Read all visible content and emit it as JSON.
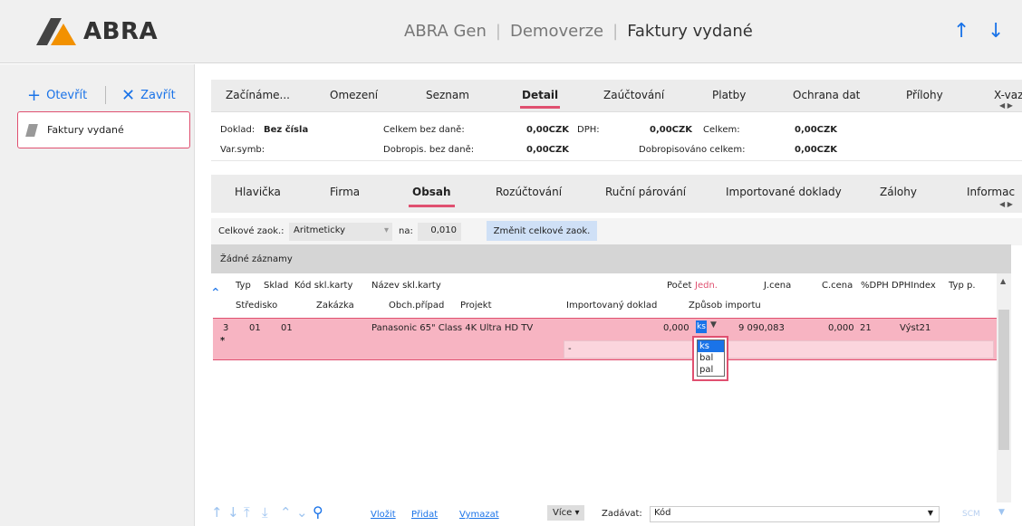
{
  "app": {
    "logo": "ABRA",
    "title_parts": [
      "ABRA Gen",
      "Demoverze"
    ],
    "current": "Faktury vydané"
  },
  "left": {
    "open_label": "Otevřít",
    "close_label": "Zavřít",
    "doc_item": "Faktury vydané"
  },
  "main_tabs": [
    "Začínáme...",
    "Omezení",
    "Seznam",
    "Detail",
    "Zaúčtování",
    "Platby",
    "Ochrana dat",
    "Přílohy",
    "X-vaz"
  ],
  "summary": {
    "doklad_label": "Doklad:",
    "doklad_value": "Bez čísla",
    "varsym_label": "Var.symb:",
    "celkem_bez_dane_label": "Celkem bez daně:",
    "celkem_bez_dane_value": "0,00CZK",
    "dph_label": "DPH:",
    "dph_value": "0,00CZK",
    "celkem_label": "Celkem:",
    "celkem_value": "0,00CZK",
    "dobropis_label": "Dobropis. bez daně:",
    "dobropis_value": "0,00CZK",
    "dobropisovano_label": "Dobropisováno celkem:",
    "dobropisovano_value": "0,00CZK"
  },
  "sub_tabs": [
    "Hlavička",
    "Firma",
    "Obsah",
    "Rozúčtování",
    "Ruční párování",
    "Importované doklady",
    "Zálohy",
    "Informac"
  ],
  "zaok": {
    "label": "Celkové zaok.:",
    "method": "Aritmeticky",
    "na_label": "na:",
    "na_value": "0,010",
    "button": "Změnit celkové zaok."
  },
  "no_records": "Žádné záznamy",
  "grid": {
    "header1": [
      "Typ",
      "Sklad",
      "Kód skl.karty",
      "Název skl.karty",
      "Počet",
      "Jedn.",
      "J.cena",
      "C.cena",
      "%DPH",
      "DPHIndex",
      "Typ p."
    ],
    "header2": [
      "Středisko",
      "Zakázka",
      "Obch.případ",
      "Projekt",
      "Importovaný doklad",
      "Způsob importu"
    ],
    "row": {
      "typ": "3",
      "sklad": "01",
      "kod": "01",
      "nazev": "Panasonic 65\" Class 4K Ultra HD TV",
      "pocet": "0,000",
      "jedn": "ks",
      "jcena": "9 090,083",
      "ccena": "0,000",
      "dph": "21",
      "dphindex": "Výst21",
      "dash": "-",
      "marker": "*"
    },
    "unit_options": [
      "ks",
      "bal",
      "pal"
    ]
  },
  "bottom": {
    "insert": "Vložit",
    "add": "Přidat",
    "delete": "Vymazat",
    "more": "Více",
    "enter_label": "Zadávat:",
    "enter_value": "Kód",
    "scm": "SCM"
  }
}
